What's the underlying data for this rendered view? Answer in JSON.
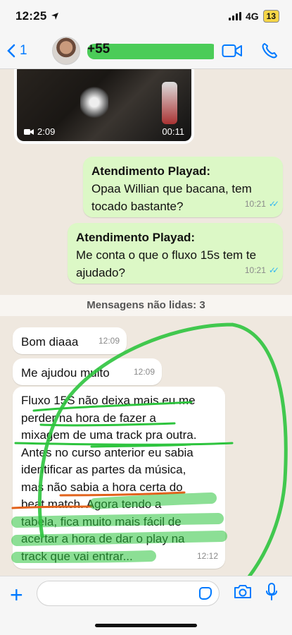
{
  "status_bar": {
    "time": "12:25",
    "network": "4G",
    "battery": "13"
  },
  "header": {
    "back_count": "1",
    "contact": "+55"
  },
  "video": {
    "duration": "2:09",
    "timestamp": "00:11"
  },
  "messages": [
    {
      "sender": "Atendimento Playad:",
      "text": "Opaa Willian que bacana, tem tocado bastante?",
      "time": "10:21"
    },
    {
      "sender": "Atendimento Playad:",
      "text": "Me conta o que o fluxo 15s tem te ajudado?",
      "time": "10:21"
    }
  ],
  "unread_divider": "Mensagens não lidas: 3",
  "incoming": [
    {
      "text": "Bom diaaa",
      "time": "12:09"
    },
    {
      "text": "Me ajudou muito",
      "time": "12:09"
    },
    {
      "lines": [
        "Fluxo 15S não deixa mais eu me",
        "perder na hora de fazer a",
        "mixagem de uma track pra outra.",
        "Antes no curso anterior eu sabia",
        "identificar as partes da música,",
        "mas não sabia a hora certa do",
        "beat match. Agora tendo a",
        "tabela, fica muito mais fácil de",
        "acertar a hora de dar o play na",
        "track que vai entrar..."
      ],
      "time": "12:12"
    }
  ],
  "input": {
    "placeholder": ""
  },
  "colors": {
    "accent": "#007aff",
    "outgoing": "#dcf8c6",
    "annotation_green": "#2ec43e",
    "annotation_orange": "#e2621b"
  }
}
